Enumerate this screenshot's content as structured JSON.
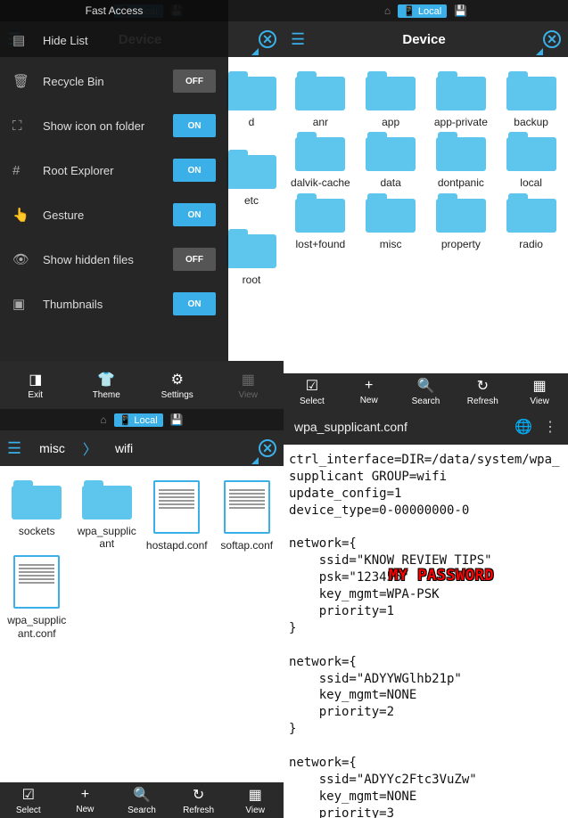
{
  "status": {
    "local": "Local"
  },
  "pane1": {
    "title": "Fast Access",
    "items": [
      {
        "icon": "list",
        "label": "Hide List",
        "toggle": null
      },
      {
        "icon": "trash",
        "label": "Recycle Bin",
        "toggle": "OFF"
      },
      {
        "icon": "res",
        "label": "Show icon on folder",
        "toggle": "ON"
      },
      {
        "icon": "root",
        "label": "Root Explorer",
        "toggle": "ON"
      },
      {
        "icon": "hand",
        "label": "Gesture",
        "toggle": "ON"
      },
      {
        "icon": "eye",
        "label": "Show hidden files",
        "toggle": "OFF"
      },
      {
        "icon": "thumb",
        "label": "Thumbnails",
        "toggle": "ON"
      }
    ],
    "visible_folders": [
      {
        "label": "d"
      },
      {
        "label": "etc"
      },
      {
        "label": "root"
      }
    ],
    "bottom": [
      "Exit",
      "Theme",
      "Settings",
      "View"
    ]
  },
  "pane2": {
    "title": "Device",
    "folders": [
      {
        "label": "anr"
      },
      {
        "label": "app"
      },
      {
        "label": "app-private"
      },
      {
        "label": "backup"
      },
      {
        "label": "dalvik-cache"
      },
      {
        "label": "data"
      },
      {
        "label": "dontpanic"
      },
      {
        "label": "local"
      },
      {
        "label": "lost+found"
      },
      {
        "label": "misc"
      },
      {
        "label": "property"
      },
      {
        "label": "radio"
      }
    ],
    "bottom": [
      "Select",
      "New",
      "Search",
      "Refresh",
      "View"
    ]
  },
  "pane3": {
    "bc1": "misc",
    "bc2": "wifi",
    "items": [
      {
        "type": "folder",
        "label": "sockets"
      },
      {
        "type": "folder",
        "label": "wpa_supplicant"
      },
      {
        "type": "file",
        "label": "hostapd.conf"
      },
      {
        "type": "file",
        "label": "softap.conf"
      },
      {
        "type": "file",
        "label": "wpa_supplicant.conf"
      }
    ],
    "bottom": [
      "Select",
      "New",
      "Search",
      "Refresh",
      "View"
    ]
  },
  "pane4": {
    "filename": "wpa_supplicant.conf",
    "content": "ctrl_interface=DIR=/data/system/wpa_supplicant GROUP=wifi\nupdate_config=1\ndevice_type=0-00000000-0\n\nnetwork={\n    ssid=\"KNOW REVIEW TIPS\"\n    psk=\"123456\"\n    key_mgmt=WPA-PSK\n    priority=1\n}\n\nnetwork={\n    ssid=\"ADYYWGlhb21p\"\n    key_mgmt=NONE\n    priority=2\n}\n\nnetwork={\n    ssid=\"ADYYc2Ftc3VuZw\"\n    key_mgmt=NONE\n    priority=3",
    "badge": "MY PASSWORD"
  }
}
